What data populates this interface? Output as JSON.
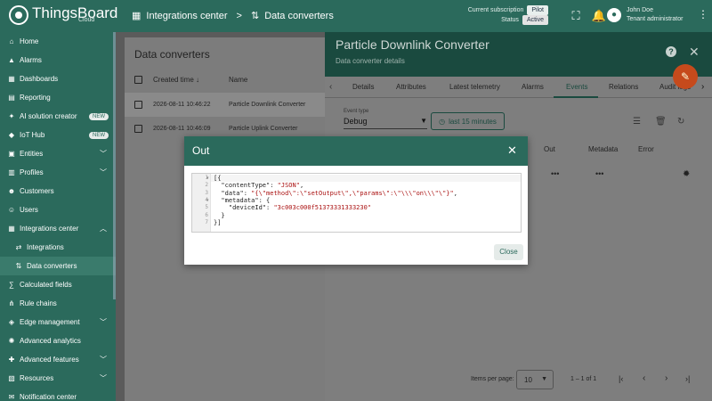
{
  "header": {
    "logo_text": "ThingsBoard",
    "logo_sub": "Cloud",
    "breadcrumb": [
      {
        "label": "Integrations center",
        "icon": "integrations-icon"
      },
      {
        "label": "Data converters",
        "icon": "converter-icon"
      }
    ],
    "subscription_label": "Current subscription",
    "subscription_value": "Pilot",
    "status_label": "Status",
    "status_value": "Active",
    "user_name": "John Doe",
    "user_role": "Tenant administrator"
  },
  "sidebar": {
    "items": [
      {
        "label": "Home",
        "icon": "home-icon"
      },
      {
        "label": "Alarms",
        "icon": "alarm-icon"
      },
      {
        "label": "Dashboards",
        "icon": "dashboard-icon"
      },
      {
        "label": "Reporting",
        "icon": "reporting-icon"
      },
      {
        "label": "AI solution creator",
        "icon": "ai-icon",
        "badge": "NEW"
      },
      {
        "label": "IoT Hub",
        "icon": "iot-hub-icon",
        "badge": "NEW"
      },
      {
        "label": "Entities",
        "icon": "entities-icon",
        "chevron": "down"
      },
      {
        "label": "Profiles",
        "icon": "profiles-icon",
        "chevron": "down"
      },
      {
        "label": "Customers",
        "icon": "customers-icon"
      },
      {
        "label": "Users",
        "icon": "users-icon"
      },
      {
        "label": "Integrations center",
        "icon": "integrations-icon",
        "chevron": "up"
      },
      {
        "label": "Integrations",
        "icon": "integration-icon",
        "sub": true
      },
      {
        "label": "Data converters",
        "icon": "converter-icon",
        "sub": true,
        "active": true
      },
      {
        "label": "Calculated fields",
        "icon": "calculated-icon"
      },
      {
        "label": "Rule chains",
        "icon": "rule-chain-icon"
      },
      {
        "label": "Edge management",
        "icon": "edge-icon",
        "chevron": "down"
      },
      {
        "label": "Advanced analytics",
        "icon": "analytics-icon"
      },
      {
        "label": "Advanced features",
        "icon": "features-icon",
        "chevron": "down"
      },
      {
        "label": "Resources",
        "icon": "resources-icon",
        "chevron": "down"
      },
      {
        "label": "Notification center",
        "icon": "notification-icon"
      }
    ]
  },
  "list": {
    "title": "Data converters",
    "col_created": "Created time",
    "col_name": "Name",
    "rows": [
      {
        "created": "2026-08-11 10:46:22",
        "name": "Particle Downlink Converter"
      },
      {
        "created": "2026-08-11 10:46:09",
        "name": "Particle Uplink Converter"
      }
    ]
  },
  "panel": {
    "title": "Particle Downlink Converter",
    "subtitle": "Data converter details",
    "tabs": [
      "Details",
      "Attributes",
      "Latest telemetry",
      "Alarms",
      "Events",
      "Relations",
      "Audit logs"
    ],
    "active_tab": "Events",
    "event_type_label": "Event type",
    "event_type_value": "Debug",
    "time_button": "last 15 minutes",
    "cols": [
      "Out",
      "Metadata",
      "Error"
    ],
    "dots": "•••",
    "items_per_page_label": "Items per page:",
    "items_per_page_value": "10",
    "range": "1 – 1 of 1"
  },
  "dialog": {
    "title": "Out",
    "close_label": "Close",
    "code_lines": [
      "[{",
      "  \"contentType\": \"JSON\",",
      "  \"data\": \"{\\\"method\\\":\\\"setOutput\\\",\\\"params\\\":\\\"\\\\\\\"on\\\\\\\"\\\"}\",",
      "  \"metadata\": {",
      "    \"deviceId\": \"3c003c000f51373331333230\"",
      "  }",
      "}]"
    ],
    "line_numbers": [
      "1",
      "2",
      "3",
      "4",
      "5",
      "6",
      "7"
    ]
  }
}
